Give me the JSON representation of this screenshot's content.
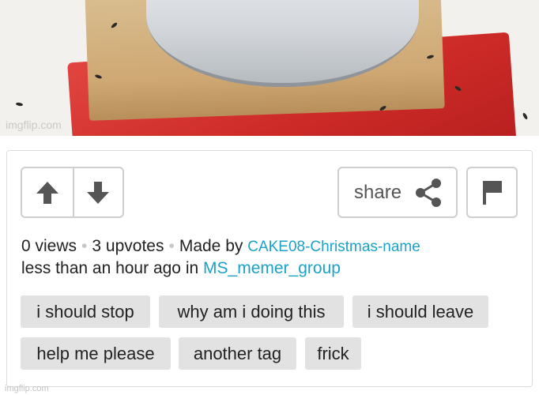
{
  "meme": {
    "watermark": "imgflip.com"
  },
  "actions": {
    "upvote_icon": "arrow-up-icon",
    "downvote_icon": "arrow-down-icon",
    "share_label": "share",
    "share_icon": "share-icon",
    "flag_icon": "flag-icon"
  },
  "stats": {
    "views": "0 views",
    "separator": "•",
    "upvotes": "3 upvotes",
    "made_by_prefix": "Made by",
    "author": "CAKE08-Christmas-name",
    "time_prefix": "less than an hour ago in",
    "stream": "MS_memer_group"
  },
  "tags": [
    "i should stop",
    "why am i doing this",
    "i should leave",
    "help me please",
    "another tag",
    "frick"
  ],
  "footer": {
    "watermark": "imgflip.com"
  },
  "colors": {
    "link": "#1aa2c8",
    "tag_bg": "#e2e2e2",
    "border": "#cfcfcf",
    "icon": "#555555"
  }
}
